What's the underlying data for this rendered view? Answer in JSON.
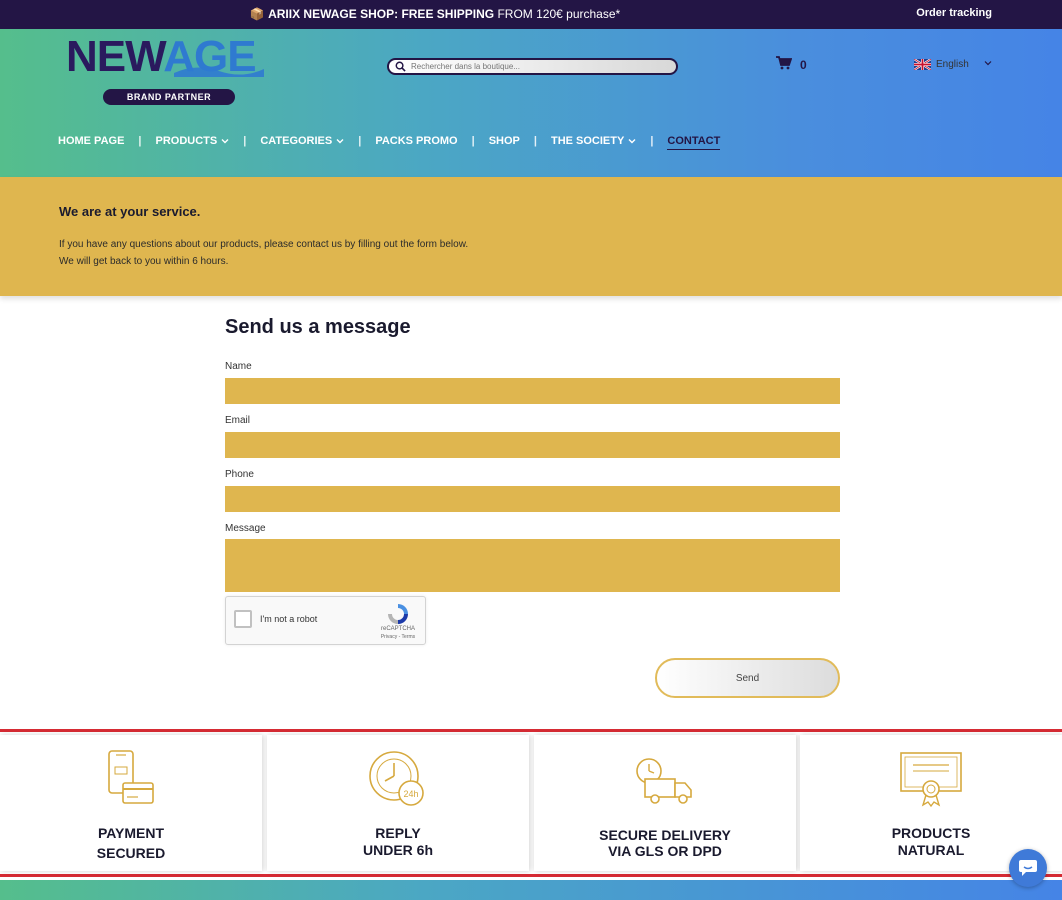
{
  "topbar": {
    "promo_emoji": "📦",
    "promo_lead": "ARIIX NEWAGE SHOP:",
    "promo_bold": "FREE SHIPPING",
    "promo_tail": "FROM 120€ purchase*",
    "order_tracking": "Order tracking"
  },
  "header": {
    "logo_new": "NEW",
    "logo_age": "AGE",
    "logo_badge": "BRAND PARTNER",
    "search_placeholder": "Rechercher dans la boutique...",
    "cart_count": "0",
    "language": "English"
  },
  "nav": {
    "items": [
      {
        "label": "HOME PAGE",
        "dropdown": false
      },
      {
        "label": "PRODUCTS",
        "dropdown": true
      },
      {
        "label": "CATEGORIES",
        "dropdown": true
      },
      {
        "label": "PACKS PROMO",
        "dropdown": false
      },
      {
        "label": "SHOP",
        "dropdown": false
      },
      {
        "label": "THE SOCIETY",
        "dropdown": true
      },
      {
        "label": "CONTACT",
        "dropdown": false,
        "active": true
      }
    ]
  },
  "service": {
    "title": "We are at your service.",
    "line1": "If you have any questions about our products, please contact us by filling out the form below.",
    "line2": "We will get back to you within 6 hours."
  },
  "form": {
    "heading": "Send us a message",
    "name_label": "Name",
    "email_label": "Email",
    "phone_label": "Phone",
    "message_label": "Message",
    "recaptcha_text": "I'm not a robot",
    "recaptcha_brand": "reCAPTCHA",
    "recaptcha_terms": "Privacy - Terms",
    "send_label": "Send"
  },
  "features": [
    {
      "line1": "PAYMENT",
      "line2": "SECURED",
      "icon": "payment-card-icon"
    },
    {
      "line1": "REPLY",
      "line2": "UNDER 6h",
      "icon": "clock-24h-icon"
    },
    {
      "line1": "SECURE DELIVERY",
      "line2": "VIA GLS OR DPD",
      "icon": "delivery-truck-icon"
    },
    {
      "line1": "PRODUCTS",
      "line2": "NATURAL",
      "icon": "certificate-icon"
    }
  ],
  "colors": {
    "topbar": "#231545",
    "gold": "#dfb64f",
    "gradient_start": "#55be8c",
    "gradient_end": "#4584e6",
    "feature_border": "#d62b34"
  }
}
